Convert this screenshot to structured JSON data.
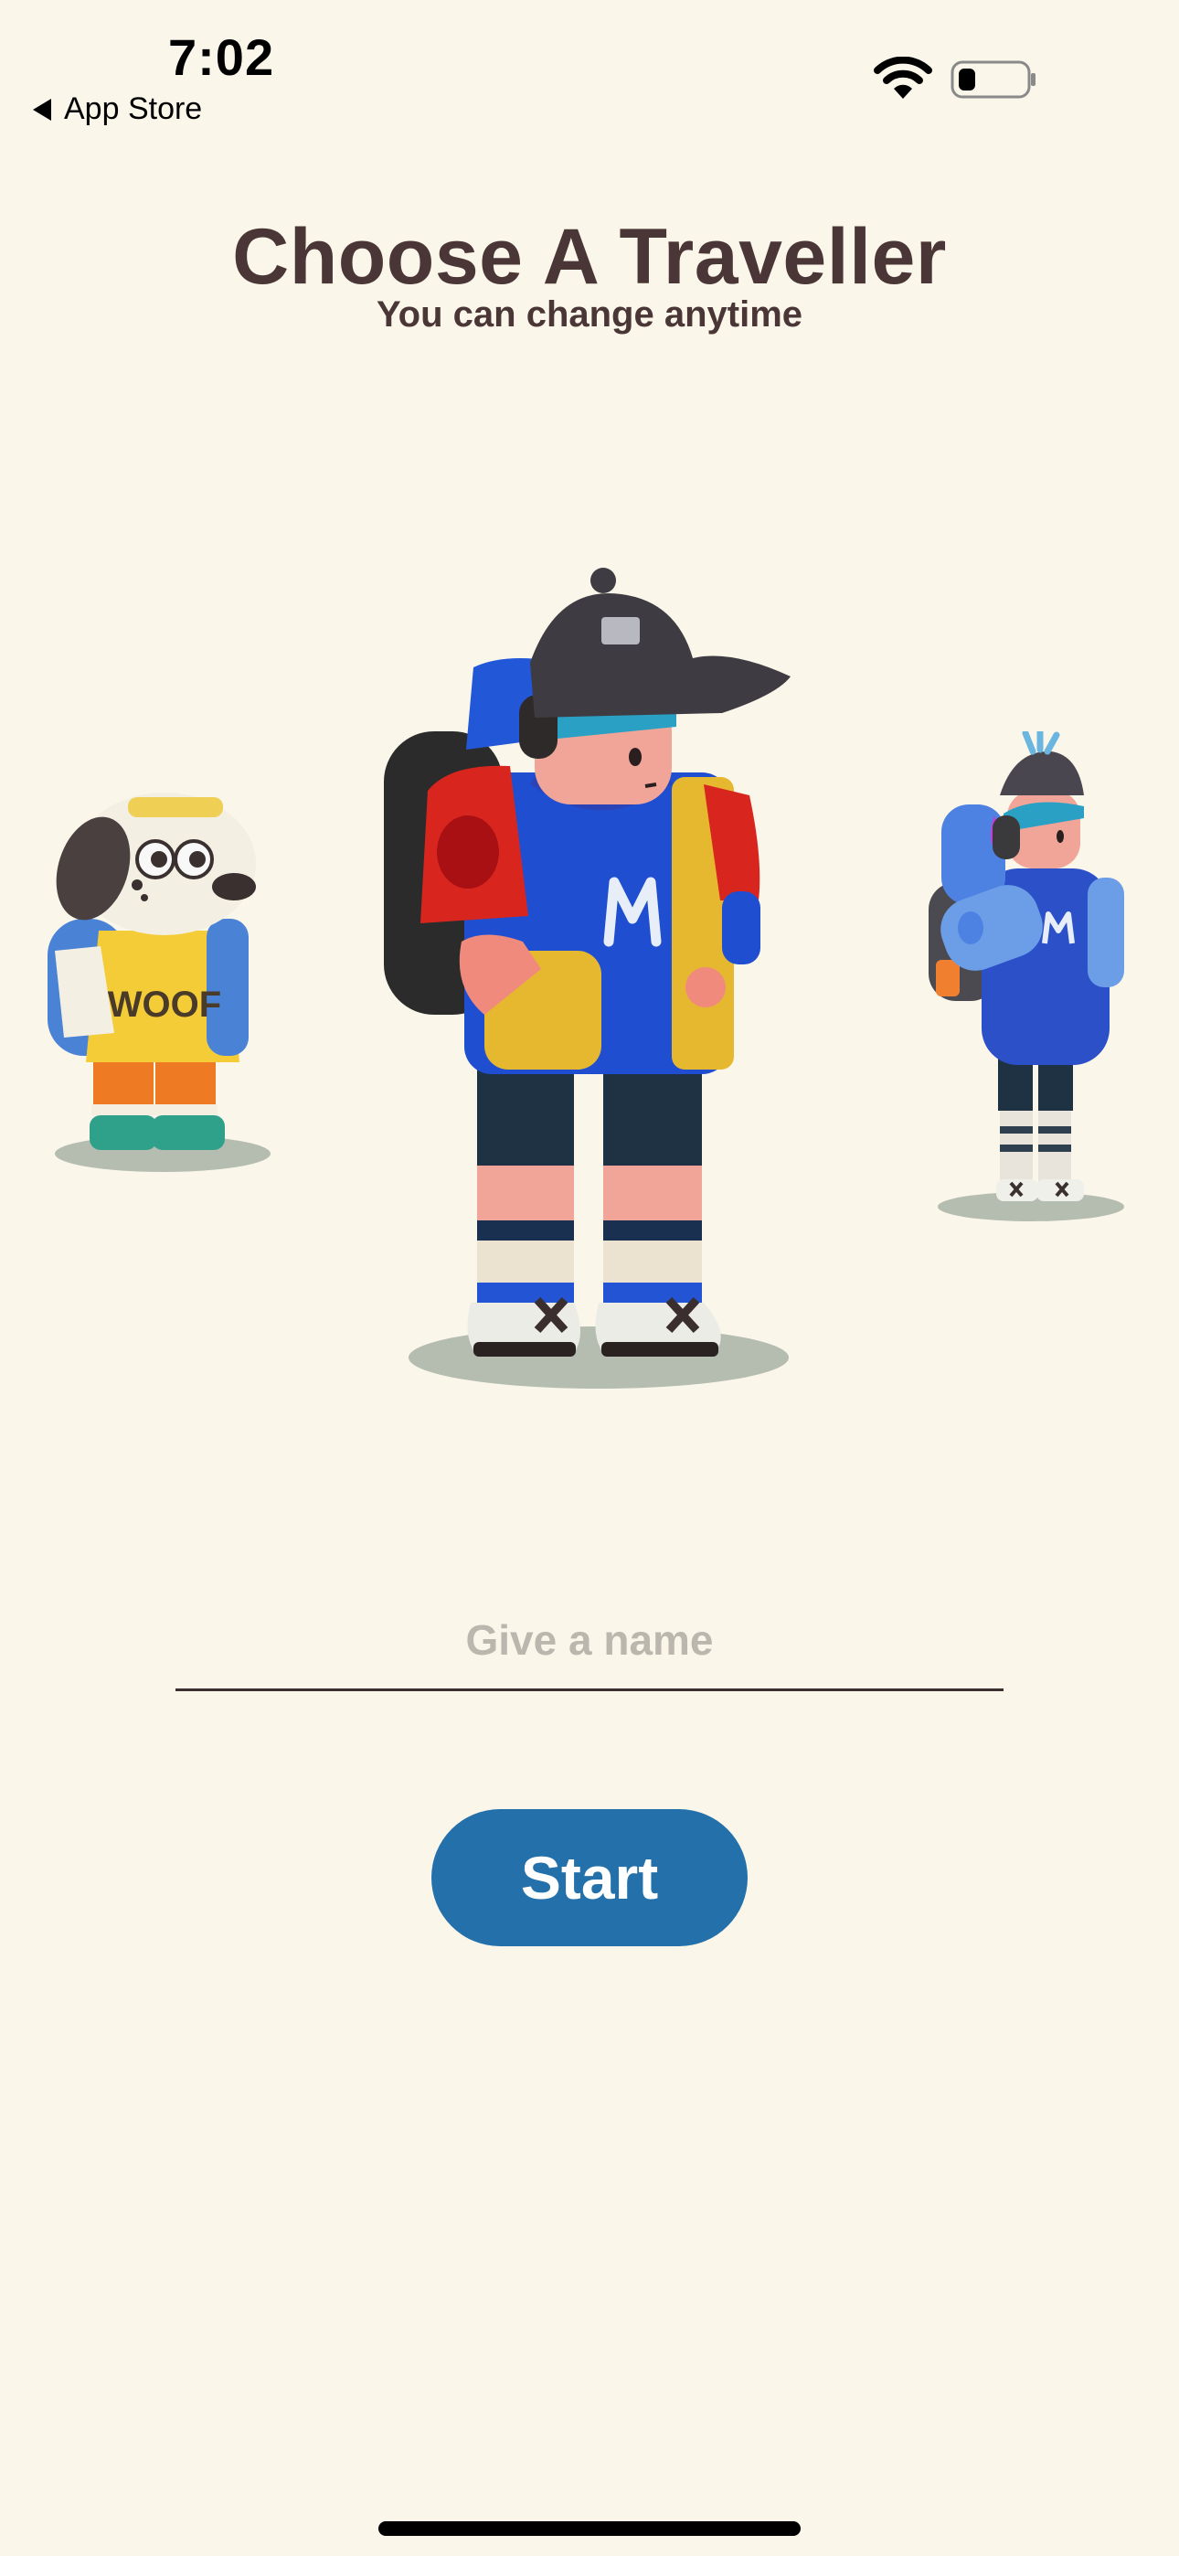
{
  "status_bar": {
    "time": "7:02",
    "back_label": "App Store",
    "icons": [
      "wifi-icon",
      "battery-icon"
    ]
  },
  "header": {
    "title": "Choose A Traveller",
    "subtitle": "You can change anytime"
  },
  "characters": [
    {
      "name": "dog",
      "shirt_text": "WOOF"
    },
    {
      "name": "boy"
    },
    {
      "name": "girl"
    }
  ],
  "form": {
    "name_placeholder": "Give a name",
    "name_value": "",
    "start_label": "Start"
  },
  "colors": {
    "background": "#faf6ea",
    "title": "#4a3636",
    "button": "#2370aa",
    "placeholder": "#bcb7ae"
  }
}
